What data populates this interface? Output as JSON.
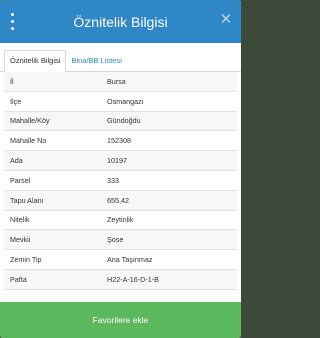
{
  "header": {
    "title": "Öznitelik Bilgisi"
  },
  "tabs": [
    {
      "label": "Öznitelik Bilgisi"
    },
    {
      "label": "Bina/BB Listesi"
    }
  ],
  "rows": [
    {
      "key": "İl",
      "value": "Bursa"
    },
    {
      "key": "İlçe",
      "value": "Osmangazi"
    },
    {
      "key": "Mahalle/Köy",
      "value": "Gündoğdu"
    },
    {
      "key": "Mahalle No",
      "value": "152308"
    },
    {
      "key": "Ada",
      "value": "10197"
    },
    {
      "key": "Parsel",
      "value": "333"
    },
    {
      "key": "Tapu Alanı",
      "value": "655,42"
    },
    {
      "key": "Nitelik",
      "value": "Zeytinlik"
    },
    {
      "key": "Mevkii",
      "value": "Şose"
    },
    {
      "key": "Zemin Tip",
      "value": "Ana Taşınmaz"
    },
    {
      "key": "Pafta",
      "value": "H22-A-16-D-1-B"
    }
  ],
  "footer": {
    "button_label": "Favorilere ekle"
  },
  "icons": {
    "menu": "more-vertical-icon",
    "close": "close-icon"
  },
  "colors": {
    "header": "#2f87c8",
    "footer": "#5cb85c"
  }
}
